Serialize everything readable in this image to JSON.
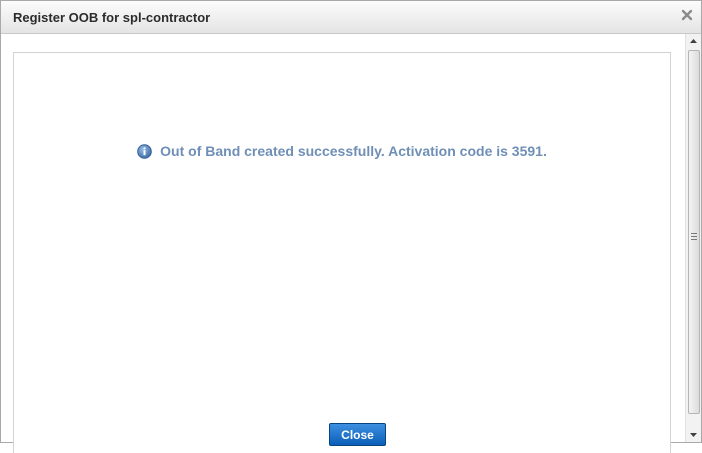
{
  "dialog": {
    "title": "Register OOB for spl-contractor",
    "close_icon": "close-icon"
  },
  "message": {
    "icon": "info-icon",
    "text": "Out of Band created successfully. Activation code is 3591."
  },
  "actions": {
    "close_label": "Close"
  },
  "colors": {
    "message_text": "#6f8fb6",
    "button_primary": "#0a5fb8",
    "title_text": "#2c2c2c"
  },
  "scrollbar": {
    "icons": [
      "scroll-up-arrow-icon",
      "scroll-down-arrow-icon"
    ]
  }
}
